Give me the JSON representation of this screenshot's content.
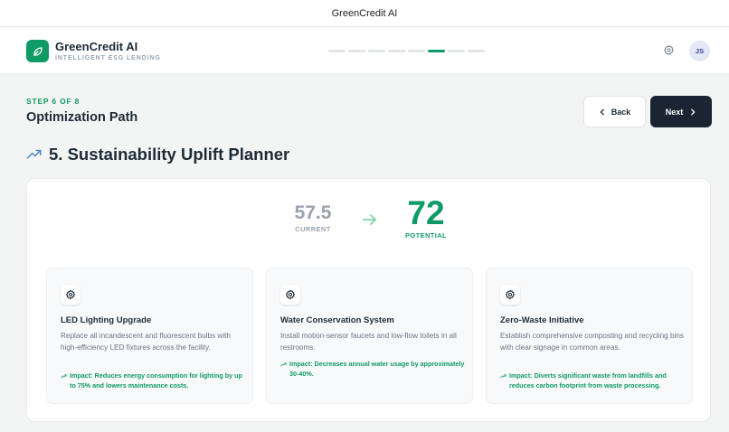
{
  "window": {
    "title": "GreenCredit AI"
  },
  "header": {
    "brand_name": "GreenCredit AI",
    "brand_tagline": "INTELLIGENT ESG LENDING",
    "progress": {
      "total_steps": 8,
      "current_step": 6
    },
    "settings_icon": "gear-icon",
    "avatar_initials": "JS"
  },
  "page": {
    "step_label": "STEP 6 OF 8",
    "title": "Optimization Path",
    "back_label": "Back",
    "next_label": "Next"
  },
  "section": {
    "icon": "trending-up-icon",
    "title": "5. Sustainability Uplift Planner"
  },
  "scores": {
    "current_value": "57.5",
    "current_label": "CURRENT",
    "potential_value": "72",
    "potential_label": "POTENTIAL"
  },
  "initiatives": [
    {
      "icon": "gear-icon",
      "title": "LED Lighting Upgrade",
      "description": "Replace all incandescent and fluorescent bulbs with high-efficiency LED fixtures across the facility.",
      "impact": "Impact: Reduces energy consumption for lighting by up to 75% and lowers maintenance costs."
    },
    {
      "icon": "gear-icon",
      "title": "Water Conservation System",
      "description": "Install motion-sensor faucets and low-flow toilets in all restrooms.",
      "impact": "Impact: Decreases annual water usage by approximately 30-40%."
    },
    {
      "icon": "gear-icon",
      "title": "Zero-Waste Initiative",
      "description": "Establish comprehensive composting and recycling bins with clear signage in common areas.",
      "impact": "Impact: Diverts significant waste from landfills and reduces carbon footprint from waste processing."
    }
  ],
  "colors": {
    "brand_green": "#0f9a66",
    "dark_button": "#1b2433",
    "muted_text": "#9aa3ae"
  }
}
